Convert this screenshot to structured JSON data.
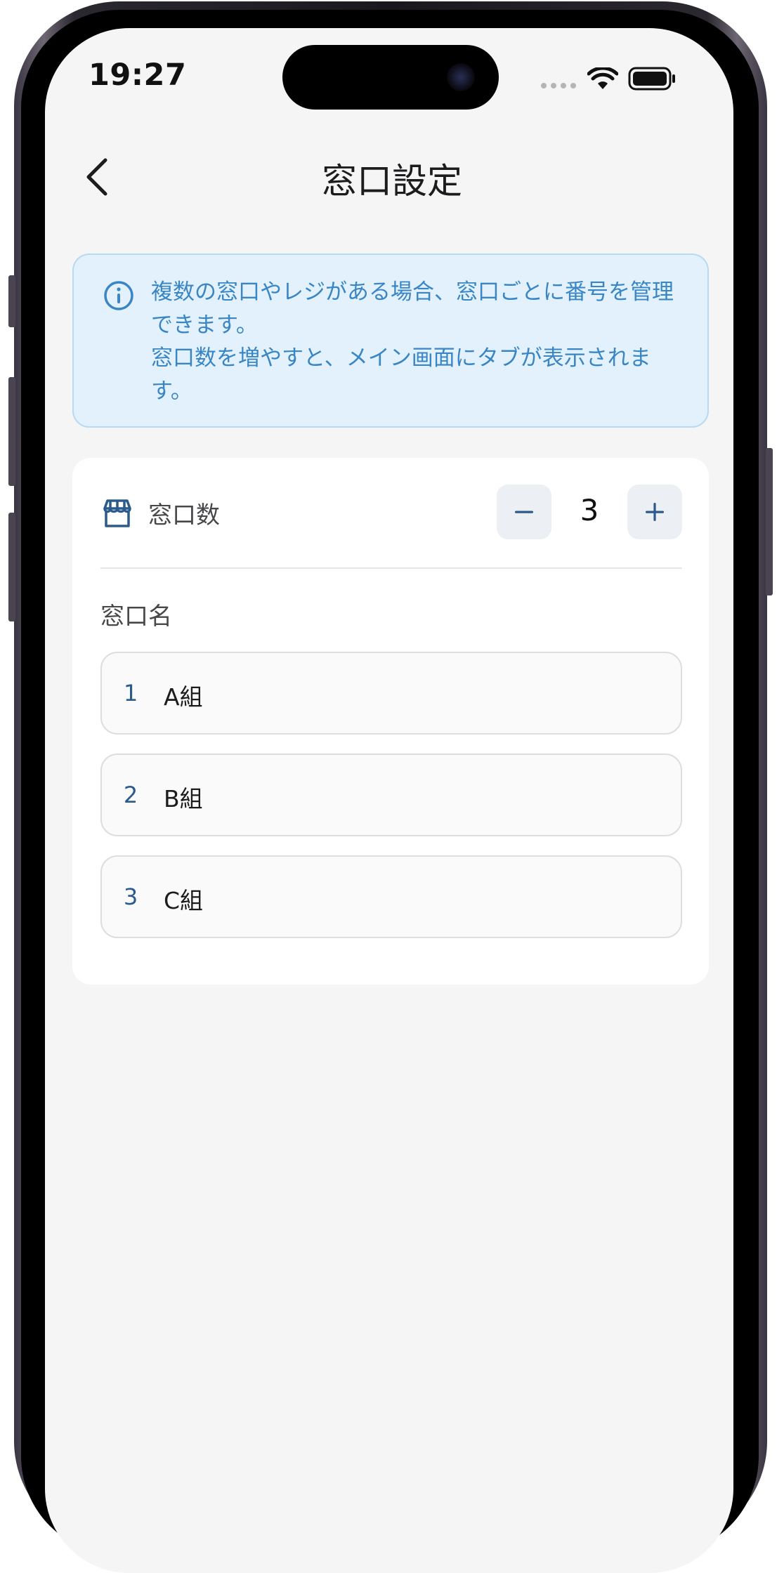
{
  "status_bar": {
    "time": "19:27"
  },
  "header": {
    "title": "窓口設定"
  },
  "info": {
    "paragraph1": "複数の窓口やレジがある場合、窓口ごとに番号を管理できます。",
    "paragraph2": "窓口数を増やすと、メイン画面にタブが表示されます。"
  },
  "counter": {
    "label": "窓口数",
    "value": "3"
  },
  "windows": {
    "label": "窓口名",
    "items": [
      {
        "index": "1",
        "name": "A組"
      },
      {
        "index": "2",
        "name": "B組"
      },
      {
        "index": "3",
        "name": "C組"
      }
    ]
  },
  "colors": {
    "accent": "#2b5a8c",
    "info_text": "#3a86c4",
    "info_background": "#e2f1fc",
    "screen_background": "#f5f5f6"
  }
}
